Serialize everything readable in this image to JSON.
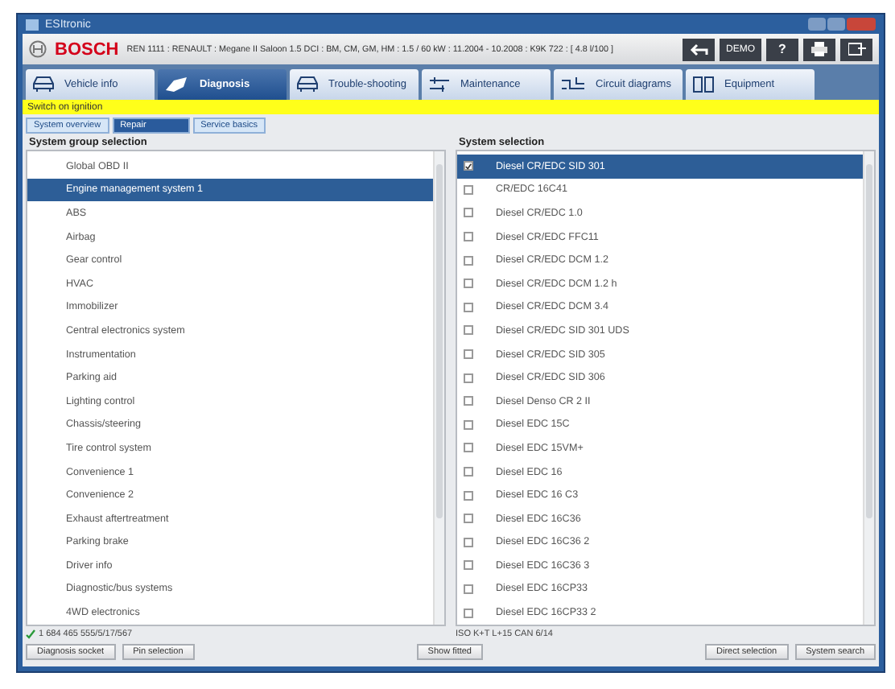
{
  "window": {
    "title": "ESItronic"
  },
  "header": {
    "brand": "BOSCH",
    "vehicle": "REN 1111 : RENAULT : Megane II Saloon 1.5 DCI : BM, CM, GM, HM : 1.5 / 60 kW : 11.2004 - 10.2008 : K9K 722 : [ 4.8 l/100 ]",
    "mode": "DEMO",
    "help": "?"
  },
  "tabs": [
    {
      "label": "Vehicle info",
      "selected": false
    },
    {
      "label": "Diagnosis",
      "selected": true
    },
    {
      "label": "Trouble-shooting",
      "selected": false
    },
    {
      "label": "Maintenance",
      "selected": false
    },
    {
      "label": "Circuit diagrams",
      "selected": false
    },
    {
      "label": "Equipment",
      "selected": false
    }
  ],
  "notice": "Switch on ignition",
  "subtabs": [
    {
      "label": "System overview",
      "selected": false
    },
    {
      "label": "Repair",
      "selected": true
    },
    {
      "label": "Service basics",
      "selected": false
    }
  ],
  "left": {
    "title": "System group selection",
    "items": [
      {
        "label": "Global OBD II",
        "selected": false
      },
      {
        "label": "Engine management system 1",
        "selected": true
      },
      {
        "label": "ABS",
        "selected": false
      },
      {
        "label": "Airbag",
        "selected": false
      },
      {
        "label": "Gear control",
        "selected": false
      },
      {
        "label": "HVAC",
        "selected": false
      },
      {
        "label": "Immobilizer",
        "selected": false
      },
      {
        "label": "Central electronics system",
        "selected": false
      },
      {
        "label": "Instrumentation",
        "selected": false
      },
      {
        "label": "Parking aid",
        "selected": false
      },
      {
        "label": "Lighting control",
        "selected": false
      },
      {
        "label": "Chassis/steering",
        "selected": false
      },
      {
        "label": "Tire control system",
        "selected": false
      },
      {
        "label": "Convenience 1",
        "selected": false
      },
      {
        "label": "Convenience 2",
        "selected": false
      },
      {
        "label": "Exhaust aftertreatment",
        "selected": false
      },
      {
        "label": "Parking brake",
        "selected": false
      },
      {
        "label": "Driver info",
        "selected": false
      },
      {
        "label": "Diagnostic/bus systems",
        "selected": false
      },
      {
        "label": "4WD electronics",
        "selected": false
      }
    ],
    "status": "1 684 465 555/5/17/567"
  },
  "right": {
    "title": "System selection",
    "items": [
      {
        "label": "Diesel CR/EDC SID 301",
        "selected": true,
        "checked": true
      },
      {
        "label": "CR/EDC 16C41",
        "selected": false,
        "checked": false
      },
      {
        "label": "Diesel CR/EDC 1.0",
        "selected": false,
        "checked": false
      },
      {
        "label": "Diesel CR/EDC FFC11",
        "selected": false,
        "checked": false
      },
      {
        "label": "Diesel CR/EDC DCM 1.2",
        "selected": false,
        "checked": false
      },
      {
        "label": "Diesel CR/EDC DCM 1.2 h",
        "selected": false,
        "checked": false
      },
      {
        "label": "Diesel CR/EDC DCM 3.4",
        "selected": false,
        "checked": false
      },
      {
        "label": "Diesel CR/EDC SID 301 UDS",
        "selected": false,
        "checked": false
      },
      {
        "label": "Diesel CR/EDC SID 305",
        "selected": false,
        "checked": false
      },
      {
        "label": "Diesel CR/EDC SID 306",
        "selected": false,
        "checked": false
      },
      {
        "label": "Diesel Denso CR 2 II",
        "selected": false,
        "checked": false
      },
      {
        "label": "Diesel EDC 15C",
        "selected": false,
        "checked": false
      },
      {
        "label": "Diesel EDC 15VM+",
        "selected": false,
        "checked": false
      },
      {
        "label": "Diesel EDC 16",
        "selected": false,
        "checked": false
      },
      {
        "label": "Diesel EDC 16 C3",
        "selected": false,
        "checked": false
      },
      {
        "label": "Diesel EDC 16C36",
        "selected": false,
        "checked": false
      },
      {
        "label": "Diesel EDC 16C36 2",
        "selected": false,
        "checked": false
      },
      {
        "label": "Diesel EDC 16C36 3",
        "selected": false,
        "checked": false
      },
      {
        "label": "Diesel EDC 16CP33",
        "selected": false,
        "checked": false
      },
      {
        "label": "Diesel EDC 16CP33 2",
        "selected": false,
        "checked": false
      }
    ],
    "status": "ISO K+T L+15 CAN 6/14"
  },
  "buttons": {
    "left": [
      "Diagnosis socket",
      "Pin selection"
    ],
    "center": [
      "Show fitted"
    ],
    "right": [
      "Direct selection",
      "System search"
    ]
  }
}
